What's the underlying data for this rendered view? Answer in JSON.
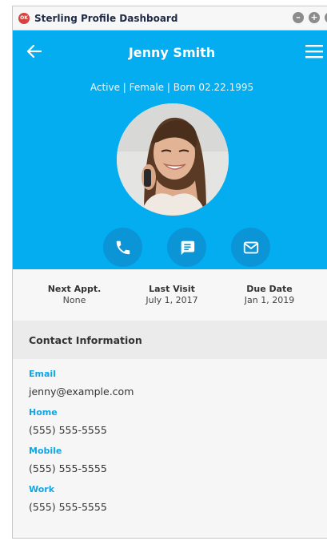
{
  "window": {
    "title": "Sterling Profile Dashboard",
    "app_icon_text": "OK"
  },
  "header": {
    "name": "Jenny Smith",
    "subtitle": "Active | Female | Born 02.22.1995",
    "accent_color": "#03adf0"
  },
  "actions": [
    {
      "icon": "phone-icon"
    },
    {
      "icon": "message-icon"
    },
    {
      "icon": "email-icon"
    }
  ],
  "stats": {
    "next_appt": {
      "label": "Next Appt.",
      "value": "None"
    },
    "last_visit": {
      "label": "Last Visit",
      "value": "July 1, 2017"
    },
    "due_date": {
      "label": "Due Date",
      "value": "Jan 1, 2019"
    }
  },
  "contact": {
    "title": "Contact Information",
    "fields": [
      {
        "label": "Email",
        "value": "jenny@example.com"
      },
      {
        "label": "Home",
        "value": "(555) 555-5555"
      },
      {
        "label": "Mobile",
        "value": "(555) 555-5555"
      },
      {
        "label": "Work",
        "value": "(555) 555-5555"
      }
    ]
  }
}
